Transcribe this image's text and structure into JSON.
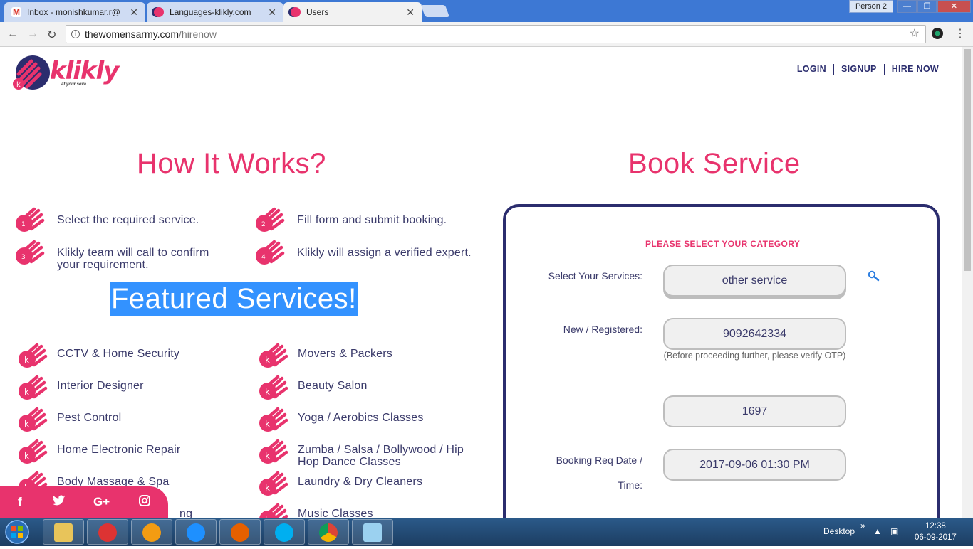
{
  "browser": {
    "tabs": [
      {
        "label": "Inbox - monishkumar.r@",
        "icon": "gmail-icon",
        "active": false
      },
      {
        "label": "Languages-klikly.com",
        "icon": "klikly-favicon",
        "active": false
      },
      {
        "label": "Users",
        "icon": "klikly-favicon",
        "active": true
      }
    ],
    "profile": "Person 2",
    "url_host": "thewomensarmy.com",
    "url_path": "/hirenow"
  },
  "site": {
    "logo": "klikly",
    "tagline": "at your seva",
    "nav": [
      "LOGIN",
      "SIGNUP",
      "HIRE NOW"
    ]
  },
  "how_it_works": {
    "title": "How It Works?",
    "steps": [
      {
        "num": "1",
        "text": "Select the required service."
      },
      {
        "num": "2",
        "text": "Fill form and submit booking."
      },
      {
        "num": "3",
        "text": "Klikly team will call to confirm your requirement."
      },
      {
        "num": "4",
        "text": "Klikly will assign a verified expert."
      }
    ]
  },
  "featured": {
    "title": "Featured Services!",
    "services": [
      "CCTV & Home Security",
      "Movers & Packers",
      "Interior Designer",
      "Beauty Salon",
      "Pest Control",
      "Yoga / Aerobics Classes",
      "Home Electronic Repair",
      "Zumba / Salsa / Bollywood / Hip Hop Dance Classes",
      "Body Massage & Spa",
      "Laundry & Dry Cleaners",
      "ng",
      "Music Classes"
    ]
  },
  "booking": {
    "title": "Book Service",
    "category_heading": "PLEASE SELECT YOUR CATEGORY",
    "service_label": "Select Your Services:",
    "service_value": "other service",
    "phone_label": "New / Registered:",
    "phone_value": "9092642334",
    "phone_note": "(Before proceeding further, please verify OTP)",
    "otp_value": "1697",
    "date_label_1": "Booking Req Date /",
    "date_label_2": "Time:",
    "date_value": "2017-09-06 01:30 PM"
  },
  "social": {
    "facebook": "f",
    "twitter": "🐦",
    "googleplus": "G+",
    "instagram": "◙"
  },
  "taskbar": {
    "desktop_label": "Desktop",
    "time": "12:38",
    "date": "06-09-2017"
  },
  "colors": {
    "accent": "#e8336d",
    "navy": "#2b2d6e",
    "highlight": "#3392ff"
  }
}
